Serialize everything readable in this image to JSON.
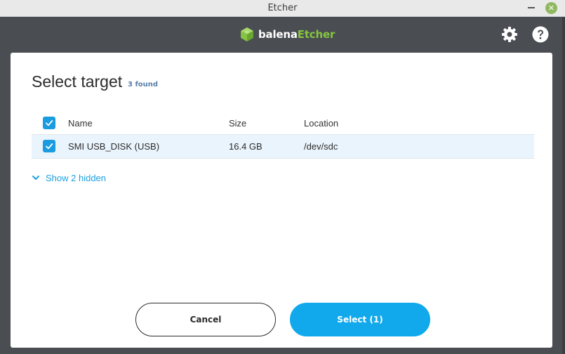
{
  "window": {
    "title": "Etcher",
    "close_glyph": "✕"
  },
  "header": {
    "brand": "balena",
    "brand_accent": "Etcher",
    "settings_icon": "gear-icon",
    "help_icon": "question-icon"
  },
  "modal": {
    "title": "Select target",
    "found_count": "3 found",
    "columns": {
      "name": "Name",
      "size": "Size",
      "location": "Location"
    },
    "rows": [
      {
        "name": "SMI USB_DISK (USB)",
        "size": "16.4 GB",
        "location": "/dev/sdc",
        "checked": true
      }
    ],
    "show_hidden": "Show 2 hidden",
    "cancel_label": "Cancel",
    "select_label": "Select (1)"
  },
  "colors": {
    "accent": "#11a9ec",
    "brand_green": "#85c442",
    "header_bg": "#4a4d52",
    "selected_row": "#eaf4fc"
  }
}
